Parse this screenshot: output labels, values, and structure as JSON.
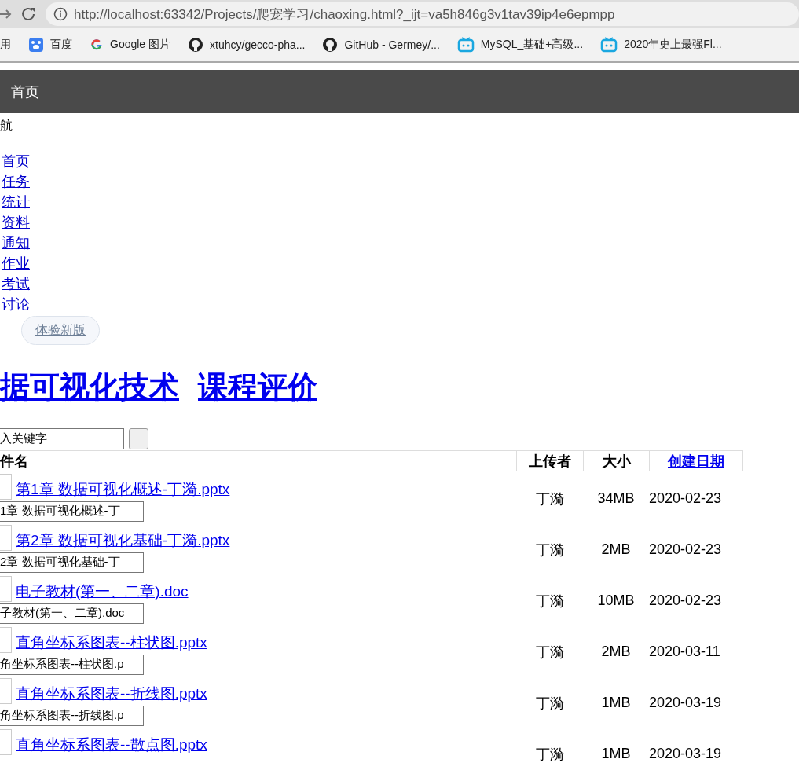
{
  "browser": {
    "address": "http://localhost:63342/Projects/爬宠学习/chaoxing.html?_ijt=va5h846g3v1tav39ip4e6epmpp",
    "bookmarks": [
      {
        "label": "用",
        "kind": "apps"
      },
      {
        "label": "百度",
        "kind": "paw"
      },
      {
        "label": "Google 图片",
        "kind": "google"
      },
      {
        "label": "xtuhcy/gecco-pha...",
        "kind": "github"
      },
      {
        "label": "GitHub - Germey/...",
        "kind": "github"
      },
      {
        "label": "MySQL_基础+高级...",
        "kind": "tv"
      },
      {
        "label": "2020年史上最强Fl...",
        "kind": "tv"
      }
    ]
  },
  "header": {
    "title": "首页"
  },
  "nav": {
    "label": "航",
    "links": [
      "首页",
      "任务",
      "统计",
      "资料",
      "通知",
      "作业",
      "考试",
      "讨论"
    ]
  },
  "new_version_button": "体验新版",
  "headings": [
    "据可视化技术",
    "课程评价"
  ],
  "search": {
    "value": "入关键字"
  },
  "table": {
    "columns": [
      {
        "label": "件名",
        "kind": "text"
      },
      {
        "label": "上传者",
        "kind": "text"
      },
      {
        "label": "大小",
        "kind": "text"
      },
      {
        "label": "创建日期",
        "kind": "link"
      }
    ],
    "rows": [
      {
        "name": "第1章 数据可视化概述-丁漪.pptx",
        "name_field": "1章 数据可视化概述-丁",
        "uploader": "丁漪",
        "size": "34MB",
        "date": "2020-02-23"
      },
      {
        "name": "第2章 数据可视化基础-丁漪.pptx",
        "name_field": "2章 数据可视化基础-丁",
        "uploader": "丁漪",
        "size": "2MB",
        "date": "2020-02-23"
      },
      {
        "name": "电子教材(第一、二章).doc",
        "name_field": "子教材(第一、二章).doc",
        "uploader": "丁漪",
        "size": "10MB",
        "date": "2020-02-23"
      },
      {
        "name": "直角坐标系图表--柱状图.pptx",
        "name_field": "角坐标系图表--柱状图.p",
        "uploader": "丁漪",
        "size": "2MB",
        "date": "2020-03-11"
      },
      {
        "name": "直角坐标系图表--折线图.pptx",
        "name_field": "角坐标系图表--折线图.p",
        "uploader": "丁漪",
        "size": "1MB",
        "date": "2020-03-19"
      },
      {
        "name": "直角坐标系图表--散点图.pptx",
        "uploader": "丁漪",
        "size": "1MB",
        "date": "2020-03-19"
      }
    ]
  }
}
